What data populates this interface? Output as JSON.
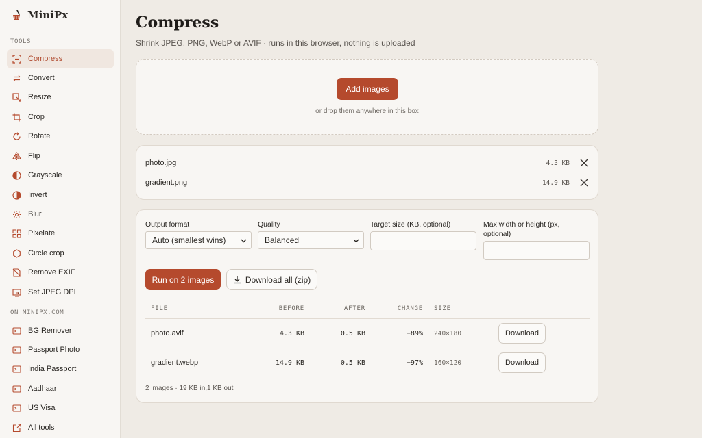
{
  "brand": {
    "name": "MiniPx",
    "logo_icon": "broom-logo-icon"
  },
  "sidebar": {
    "tools_label": "TOOLS",
    "tools": [
      {
        "label": "Compress",
        "icon": "compress-icon",
        "active": true
      },
      {
        "label": "Convert",
        "icon": "convert-icon"
      },
      {
        "label": "Resize",
        "icon": "resize-icon"
      },
      {
        "label": "Crop",
        "icon": "crop-icon"
      },
      {
        "label": "Rotate",
        "icon": "rotate-icon"
      },
      {
        "label": "Flip",
        "icon": "flip-icon"
      },
      {
        "label": "Grayscale",
        "icon": "grayscale-icon"
      },
      {
        "label": "Invert",
        "icon": "invert-icon"
      },
      {
        "label": "Blur",
        "icon": "blur-icon"
      },
      {
        "label": "Pixelate",
        "icon": "pixelate-icon"
      },
      {
        "label": "Circle crop",
        "icon": "circle-crop-icon"
      },
      {
        "label": "Remove EXIF",
        "icon": "remove-exif-icon"
      },
      {
        "label": "Set JPEG DPI",
        "icon": "dpi-icon"
      }
    ],
    "external_label": "ON MINIPX.COM",
    "external": [
      {
        "label": "BG Remover",
        "icon": "external-link-icon"
      },
      {
        "label": "Passport Photo",
        "icon": "external-link-icon"
      },
      {
        "label": "India Passport",
        "icon": "external-link-icon"
      },
      {
        "label": "Aadhaar",
        "icon": "external-link-icon"
      },
      {
        "label": "US Visa",
        "icon": "external-link-icon"
      },
      {
        "label": "All tools",
        "icon": "open-new-icon"
      }
    ]
  },
  "page": {
    "title": "Compress",
    "subtitle": "Shrink JPEG, PNG, WebP or AVIF · runs in this browser, nothing is uploaded"
  },
  "dropzone": {
    "button_label": "Add images",
    "hint": "or drop them anywhere in this box"
  },
  "files": [
    {
      "name": "photo.jpg",
      "size": "4.3 KB"
    },
    {
      "name": "gradient.png",
      "size": "14.9 KB"
    }
  ],
  "settings": {
    "output_format": {
      "label": "Output format",
      "value": "Auto (smallest wins)"
    },
    "quality": {
      "label": "Quality",
      "value": "Balanced"
    },
    "target_size": {
      "label": "Target size (KB, optional)",
      "value": ""
    },
    "max_dim": {
      "label": "Max width or height (px, optional)",
      "value": ""
    },
    "run_label": "Run on 2 images",
    "download_all_label": "Download all (zip)"
  },
  "results": {
    "columns": [
      "FILE",
      "BEFORE",
      "AFTER",
      "CHANGE",
      "SIZE"
    ],
    "rows": [
      {
        "file": "photo.avif",
        "before": "4.3 KB",
        "after": "0.5 KB",
        "change": "−89%",
        "size": "240×180",
        "action": "Download"
      },
      {
        "file": "gradient.webp",
        "before": "14.9 KB",
        "after": "0.5 KB",
        "change": "−97%",
        "size": "160×120",
        "action": "Download"
      }
    ],
    "summary": "2 images · 19 KB in,1 KB out"
  },
  "colors": {
    "accent": "#b54a2d",
    "background": "#efebe5",
    "panel": "#f8f6f3"
  }
}
